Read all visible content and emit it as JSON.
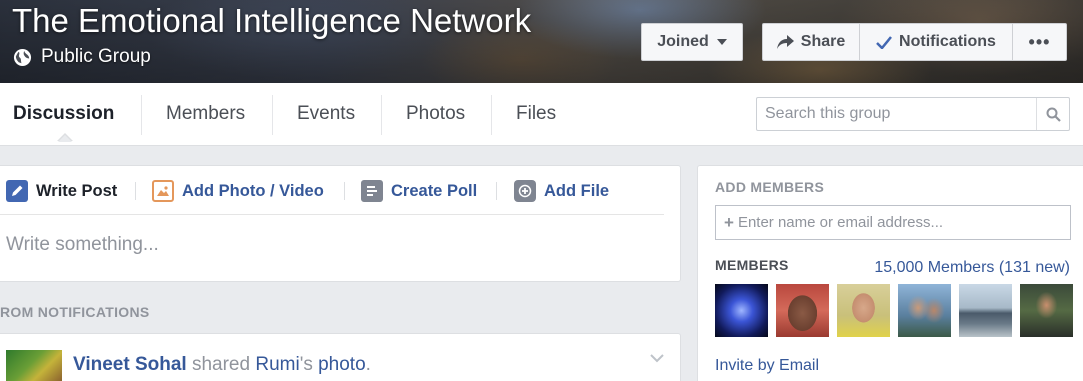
{
  "header": {
    "group_name": "The Emotional Intelligence Network",
    "privacy": "Public Group",
    "joined_label": "Joined",
    "share_label": "Share",
    "notifications_label": "Notifications",
    "more_label": "•••"
  },
  "nav": {
    "tabs": [
      {
        "label": "Discussion",
        "active": true
      },
      {
        "label": "Members"
      },
      {
        "label": "Events"
      },
      {
        "label": "Photos"
      },
      {
        "label": "Files"
      }
    ],
    "search_placeholder": "Search this group"
  },
  "composer": {
    "tabs": [
      {
        "label": "Write Post",
        "icon": "pencil-icon"
      },
      {
        "label": "Add Photo / Video",
        "icon": "photo-icon"
      },
      {
        "label": "Create Poll",
        "icon": "poll-icon"
      },
      {
        "label": "Add File",
        "icon": "file-add-icon"
      }
    ],
    "placeholder": "Write something..."
  },
  "feed": {
    "section_label": "ROM NOTIFICATIONS",
    "post": {
      "author": "Vineet Sohal",
      "verb": " shared ",
      "owner": "Rumi",
      "possessive": "'s ",
      "object": "photo",
      "end": "."
    }
  },
  "sidebar": {
    "add_members_label": "ADD MEMBERS",
    "add_members_placeholder": "Enter name or email address...",
    "members_label": "MEMBERS",
    "members_count": "15,000 Members (131 new)",
    "invite_label": "Invite by Email"
  },
  "colors": {
    "link": "#365899",
    "muted": "#90949c",
    "page_bg": "#e9ebee"
  }
}
